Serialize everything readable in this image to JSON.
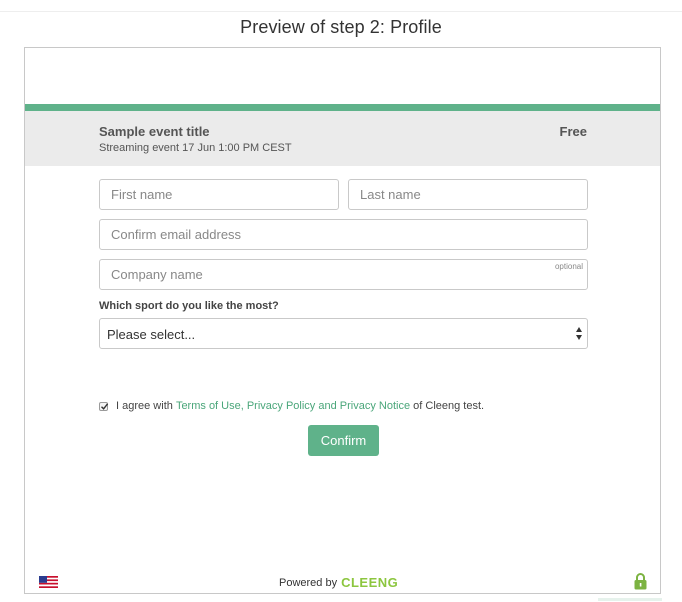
{
  "page": {
    "title": "Preview of step 2: Profile"
  },
  "event": {
    "title": "Sample event title",
    "subtitle": "Streaming event 17 Jun 1:00 PM CEST",
    "price": "Free"
  },
  "form": {
    "first_name": {
      "placeholder": "First name",
      "value": ""
    },
    "last_name": {
      "placeholder": "Last name",
      "value": ""
    },
    "confirm_email": {
      "placeholder": "Confirm email address",
      "value": ""
    },
    "company": {
      "placeholder": "Company name",
      "value": "",
      "optional_label": "optional"
    },
    "sport_question": "Which sport do you like the most?",
    "sport_select_value": "Please select...",
    "consent": {
      "checked": true,
      "prefix": "I agree with",
      "link_text": "Terms of Use, Privacy Policy and Privacy Notice",
      "suffix": "of Cleeng test."
    },
    "confirm_label": "Confirm"
  },
  "footer": {
    "powered_by": "Powered by",
    "brand": "CLEENG",
    "language_flag": "us-flag-icon",
    "secure_icon": "lock-icon"
  },
  "colors": {
    "accent": "#5fb28a",
    "brand": "#8cc63f",
    "band": "#ebebeb"
  }
}
